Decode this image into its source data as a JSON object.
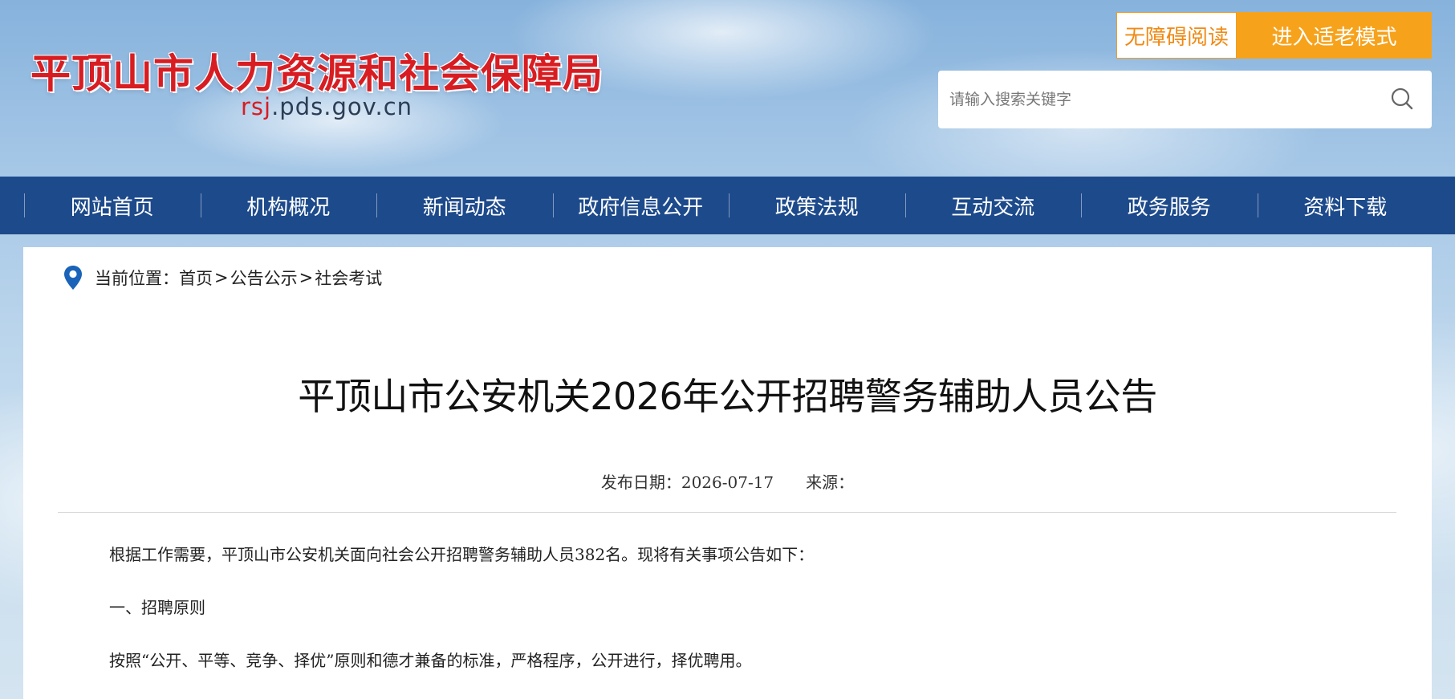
{
  "header": {
    "site_title": "平顶山市人力资源和社会保障局",
    "domain_prefix": "rsj",
    "domain_suffix": ".pds.gov.cn",
    "accessibility_button": "无障碍阅读",
    "elder_mode_button": "进入适老模式",
    "search_placeholder": "请输入搜索关键字"
  },
  "nav": {
    "items": [
      "网站首页",
      "机构概况",
      "新闻动态",
      "政府信息公开",
      "政策法规",
      "互动交流",
      "政务服务",
      "资料下载"
    ]
  },
  "breadcrumb": {
    "prefix": "当前位置：",
    "items": [
      "首页",
      "公告公示",
      "社会考试"
    ],
    "separator": ">"
  },
  "article": {
    "title": "平顶山市公安机关2026年公开招聘警务辅助人员公告",
    "date_label": "发布日期：2026-07-17",
    "source_label": "来源：",
    "paragraphs": [
      "根据工作需要，平顶山市公安机关面向社会公开招聘警务辅助人员382名。现将有关事项公告如下：",
      "一、招聘原则",
      "按照“公开、平等、竞争、择优”原则和德才兼备的标准，严格程序，公开进行，择优聘用。"
    ]
  },
  "colors": {
    "title_red": "#d81d22",
    "nav_blue": "#1d4a8b",
    "accent_orange": "#f7a21b"
  },
  "icons": [
    "search-icon",
    "location-pin-icon"
  ]
}
